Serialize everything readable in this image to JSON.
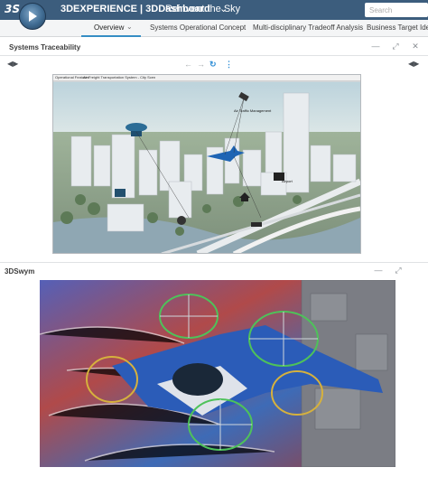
{
  "topbar": {
    "app_title": "3DEXPERIENCE | 3DDashboard",
    "dashboard_name": "Reinvent the Sky",
    "search_placeholder": "Search",
    "brand_color": "#3c5d7d"
  },
  "tabs": [
    {
      "label": "Overview",
      "active": true
    },
    {
      "label": "Systems Operational Concept"
    },
    {
      "label": "Multi-disciplinary Tradeoff Analysis"
    },
    {
      "label": "Business Target Identi"
    }
  ],
  "panel1": {
    "title": "Systems Traceability",
    "scene_tabs": [
      "Operational Features",
      "Air Freight Transportation System - City Scen"
    ],
    "scene_labels": [
      "Air Traffic Management",
      "Airport"
    ]
  },
  "panel2": {
    "title": "3DSwym"
  },
  "icons": {
    "expand": "expand-icon",
    "minimize": "minimize-icon",
    "close": "close-icon",
    "refresh": "refresh-icon",
    "more": "more-vertical-icon"
  }
}
